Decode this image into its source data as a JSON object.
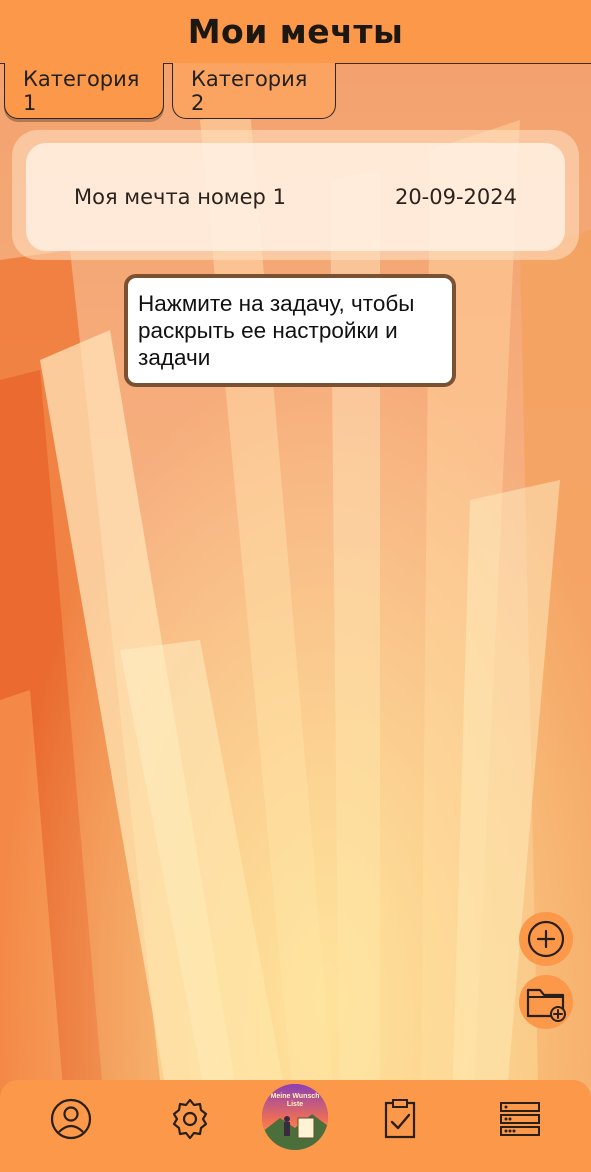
{
  "header": {
    "title": "Мои мечты"
  },
  "tabs": [
    {
      "label": "Категория 1",
      "active": true
    },
    {
      "label": "Категория 2",
      "active": false
    }
  ],
  "dream_card": {
    "title": "Моя мечта номер 1",
    "date": "20-09-2024"
  },
  "tooltip": {
    "text": "Нажмите на задачу, чтобы раскрыть ее настройки и задачи"
  },
  "fabs": {
    "add_icon": "plus-circle-icon",
    "folder_icon": "folder-add-icon"
  },
  "bottom_nav": {
    "items": [
      "user-icon",
      "gear-icon",
      "app-logo",
      "clipboard-check-icon",
      "list-icon"
    ],
    "logo_text": "Meine Wunsch Liste"
  },
  "colors": {
    "accent": "#fb984a",
    "tooltip_border": "#7a5232",
    "text_dark": "#1d1712"
  }
}
